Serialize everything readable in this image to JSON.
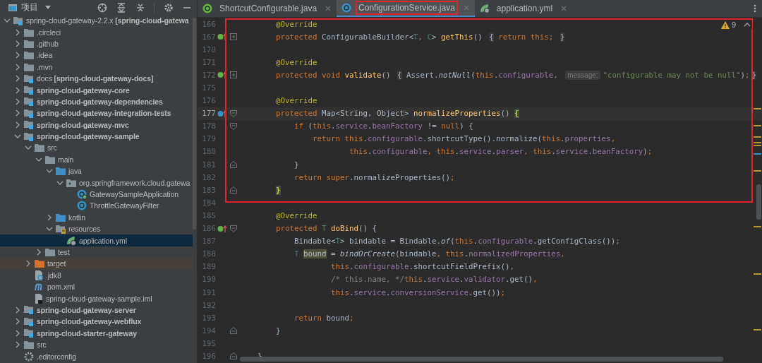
{
  "project_panel": {
    "title": "项目",
    "tree": [
      {
        "label": "spring-cloud-gateway-2.2.x **[spring-cloud-gatewa**",
        "kind": "module-alias",
        "expanded": true,
        "selected": false,
        "children": [
          {
            "label": ".circleci",
            "kind": "folder",
            "expanded": false,
            "selected": false
          },
          {
            "label": ".github",
            "kind": "folder",
            "expanded": false,
            "selected": false
          },
          {
            "label": ".idea",
            "kind": "folder",
            "expanded": false,
            "selected": false
          },
          {
            "label": ".mvn",
            "kind": "folder",
            "expanded": false,
            "selected": false
          },
          {
            "label": "docs **[spring-cloud-gateway-docs]**",
            "kind": "module-alias",
            "expanded": false,
            "selected": false
          },
          {
            "label": "spring-cloud-gateway-core",
            "kind": "module",
            "expanded": false,
            "selected": false
          },
          {
            "label": "spring-cloud-gateway-dependencies",
            "kind": "module",
            "expanded": false,
            "selected": false
          },
          {
            "label": "spring-cloud-gateway-integration-tests",
            "kind": "module",
            "expanded": false,
            "selected": false
          },
          {
            "label": "spring-cloud-gateway-mvc",
            "kind": "module",
            "expanded": false,
            "selected": false
          },
          {
            "label": "spring-cloud-gateway-sample",
            "kind": "module",
            "expanded": true,
            "selected": false,
            "children": [
              {
                "label": "src",
                "kind": "folder",
                "expanded": true,
                "selected": false,
                "children": [
                  {
                    "label": "main",
                    "kind": "folder",
                    "expanded": true,
                    "selected": false,
                    "children": [
                      {
                        "label": "java",
                        "kind": "source",
                        "expanded": true,
                        "selected": false,
                        "children": [
                          {
                            "label": "org.springframework.cloud.gatewa",
                            "kind": "package",
                            "expanded": true,
                            "selected": false,
                            "children": [
                              {
                                "label": "GatewaySampleApplication",
                                "kind": "spring-class",
                                "selected": false
                              },
                              {
                                "label": "ThrottleGatewayFilter",
                                "kind": "class",
                                "selected": false
                              }
                            ]
                          }
                        ]
                      },
                      {
                        "label": "kotlin",
                        "kind": "source",
                        "expanded": false,
                        "selected": false
                      },
                      {
                        "label": "resources",
                        "kind": "resources",
                        "expanded": true,
                        "selected": false,
                        "children": [
                          {
                            "label": "application.yml",
                            "kind": "yml",
                            "selected": true
                          }
                        ]
                      }
                    ]
                  },
                  {
                    "label": "test",
                    "kind": "folder",
                    "expanded": false,
                    "selected": false
                  }
                ]
              },
              {
                "label": "target",
                "kind": "excluded",
                "expanded": false,
                "selected": false
              },
              {
                "label": ".jdk8",
                "kind": "unknown-file",
                "selected": false
              },
              {
                "label": "pom.xml",
                "kind": "maven",
                "selected": false
              },
              {
                "label": "spring-cloud-gateway-sample.iml",
                "kind": "iml",
                "selected": false
              }
            ]
          },
          {
            "label": "spring-cloud-gateway-server",
            "kind": "module",
            "expanded": false,
            "selected": false
          },
          {
            "label": "spring-cloud-gateway-webflux",
            "kind": "module",
            "expanded": false,
            "selected": false
          },
          {
            "label": "spring-cloud-starter-gateway",
            "kind": "module",
            "expanded": false,
            "selected": false
          },
          {
            "label": "src",
            "kind": "folder",
            "expanded": false,
            "selected": false
          },
          {
            "label": ".editorconfig",
            "kind": "config",
            "selected": false
          }
        ]
      }
    ]
  },
  "tabs": [
    {
      "label": "ShortcutConfigurable.java",
      "kind": "interface",
      "selected": false,
      "highlighted": false
    },
    {
      "label": "ConfigurationService.java",
      "kind": "class",
      "selected": true,
      "highlighted": true
    },
    {
      "label": "application.yml",
      "kind": "yml",
      "selected": false,
      "highlighted": false
    }
  ],
  "editor": {
    "warnings": "9",
    "blocks": [
      {
        "boxed": true,
        "lines": [
          {
            "number": "166",
            "tokens": [
              {
                "kind": "annotation",
                "text": "        @Override"
              }
            ]
          },
          {
            "number": "167",
            "gutter": {
              "kind": "override"
            },
            "fold": {
              "kind": "collapsed"
            },
            "tokens": [
              {
                "kind": "keyword",
                "text": "        protected "
              },
              {
                "kind": "plain",
                "text": "ConfigurableBuilder<"
              },
              {
                "kind": "typeparam",
                "text": "T"
              },
              {
                "kind": "keyword",
                "text": ", "
              },
              {
                "kind": "typeparam",
                "text": "C"
              },
              {
                "kind": "plain",
                "text": "> "
              },
              {
                "kind": "method",
                "text": "getThis"
              },
              {
                "kind": "plain",
                "text": "() "
              },
              {
                "kind": "fold",
                "text": "{"
              },
              {
                "kind": "keyword",
                "text": " return this; "
              },
              {
                "kind": "fold",
                "text": "}"
              }
            ]
          },
          {
            "number": "170"
          },
          {
            "number": "171",
            "tokens": [
              {
                "kind": "annotation",
                "text": "        @Override"
              }
            ]
          },
          {
            "number": "172",
            "gutter": {
              "kind": "override"
            },
            "fold": {
              "kind": "collapsed"
            },
            "tokens": [
              {
                "kind": "keyword",
                "text": "        protected void "
              },
              {
                "kind": "method",
                "text": "validate"
              },
              {
                "kind": "plain",
                "text": "() "
              },
              {
                "kind": "fold",
                "text": "{"
              },
              {
                "kind": "plain",
                "text": " Assert."
              },
              {
                "kind": "static",
                "text": "notNull"
              },
              {
                "kind": "plain",
                "text": "("
              },
              {
                "kind": "keyword",
                "text": "this"
              },
              {
                "kind": "plain",
                "text": "."
              },
              {
                "kind": "field",
                "text": "configurable"
              },
              {
                "kind": "keyword",
                "text": ", "
              },
              {
                "kind": "hint",
                "text": "message:"
              },
              {
                "kind": "string",
                "text": "\"configurable may not be null\""
              },
              {
                "kind": "plain",
                "text": ")"
              },
              {
                "kind": "keyword",
                "text": ";"
              },
              {
                "kind": "fold",
                "text": "}"
              }
            ]
          },
          {
            "number": "175"
          },
          {
            "number": "176",
            "tokens": [
              {
                "kind": "annotation",
                "text": "        @Override"
              }
            ]
          },
          {
            "number": "177",
            "gutter": {
              "kind": "implements"
            },
            "fold": {
              "kind": "open"
            },
            "current": true,
            "tokens": [
              {
                "kind": "keyword",
                "text": "        protected "
              },
              {
                "kind": "plain",
                "text": "Map<String, Object> "
              },
              {
                "kind": "method",
                "text": "normalizeProperties"
              },
              {
                "kind": "plain",
                "text": "() "
              },
              {
                "kind": "brace",
                "text": "{"
              }
            ]
          },
          {
            "number": "178",
            "fold": {
              "kind": "open"
            },
            "tokens": [
              {
                "kind": "keyword",
                "text": "            if "
              },
              {
                "kind": "plain",
                "text": "("
              },
              {
                "kind": "keyword",
                "text": "this"
              },
              {
                "kind": "plain",
                "text": "."
              },
              {
                "kind": "field",
                "text": "service"
              },
              {
                "kind": "plain",
                "text": "."
              },
              {
                "kind": "field",
                "text": "beanFactory"
              },
              {
                "kind": "plain",
                "text": " != "
              },
              {
                "kind": "keyword",
                "text": "null"
              },
              {
                "kind": "plain",
                "text": ") {"
              }
            ]
          },
          {
            "number": "179",
            "tokens": [
              {
                "kind": "keyword",
                "text": "                return this"
              },
              {
                "kind": "plain",
                "text": "."
              },
              {
                "kind": "field",
                "text": "configurable"
              },
              {
                "kind": "plain",
                "text": ".shortcutType().normalize("
              },
              {
                "kind": "keyword",
                "text": "this"
              },
              {
                "kind": "plain",
                "text": "."
              },
              {
                "kind": "field",
                "text": "properties"
              },
              {
                "kind": "keyword",
                "text": ","
              }
            ]
          },
          {
            "number": "180",
            "tokens": [
              {
                "kind": "keyword",
                "text": "                        this"
              },
              {
                "kind": "plain",
                "text": "."
              },
              {
                "kind": "field",
                "text": "configurable"
              },
              {
                "kind": "keyword",
                "text": ", this"
              },
              {
                "kind": "plain",
                "text": "."
              },
              {
                "kind": "field",
                "text": "service"
              },
              {
                "kind": "plain",
                "text": "."
              },
              {
                "kind": "field",
                "text": "parser"
              },
              {
                "kind": "keyword",
                "text": ", this"
              },
              {
                "kind": "plain",
                "text": "."
              },
              {
                "kind": "field",
                "text": "service"
              },
              {
                "kind": "plain",
                "text": "."
              },
              {
                "kind": "field",
                "text": "beanFactory"
              },
              {
                "kind": "plain",
                "text": ")"
              },
              {
                "kind": "keyword",
                "text": ";"
              }
            ]
          },
          {
            "number": "181",
            "fold": {
              "kind": "close"
            },
            "tokens": [
              {
                "kind": "plain",
                "text": "            }"
              }
            ]
          },
          {
            "number": "182",
            "tokens": [
              {
                "kind": "keyword",
                "text": "            return super"
              },
              {
                "kind": "plain",
                "text": ".normalizeProperties()"
              },
              {
                "kind": "keyword",
                "text": ";"
              }
            ]
          },
          {
            "number": "183",
            "fold": {
              "kind": "close"
            },
            "tokens": [
              {
                "kind": "brace",
                "text": "        }"
              }
            ]
          }
        ]
      },
      {
        "boxed": false,
        "lines": [
          {
            "number": "184"
          },
          {
            "number": "185",
            "tokens": [
              {
                "kind": "annotation",
                "text": "        @Override"
              }
            ]
          },
          {
            "number": "186",
            "gutter": {
              "kind": "override"
            },
            "fold": {
              "kind": "open"
            },
            "tokens": [
              {
                "kind": "keyword",
                "text": "        protected "
              },
              {
                "kind": "typeparam",
                "text": "T "
              },
              {
                "kind": "method",
                "text": "doBind"
              },
              {
                "kind": "plain",
                "text": "() {"
              }
            ]
          },
          {
            "number": "187",
            "tokens": [
              {
                "kind": "plain",
                "text": "            Bindable<"
              },
              {
                "kind": "typeparam",
                "text": "T"
              },
              {
                "kind": "plain",
                "text": "> bindable = Bindable."
              },
              {
                "kind": "static",
                "text": "of"
              },
              {
                "kind": "plain",
                "text": "("
              },
              {
                "kind": "keyword",
                "text": "this"
              },
              {
                "kind": "plain",
                "text": "."
              },
              {
                "kind": "field",
                "text": "configurable"
              },
              {
                "kind": "plain",
                "text": ".getConfigClass())"
              },
              {
                "kind": "keyword",
                "text": ";"
              }
            ]
          },
          {
            "number": "188",
            "tokens": [
              {
                "kind": "typeparam",
                "text": "            T "
              },
              {
                "kind": "usage",
                "text": "bound"
              },
              {
                "kind": "plain",
                "text": " = "
              },
              {
                "kind": "static",
                "text": "bindOrCreate"
              },
              {
                "kind": "plain",
                "text": "(bindable"
              },
              {
                "kind": "keyword",
                "text": ", this"
              },
              {
                "kind": "plain",
                "text": "."
              },
              {
                "kind": "field",
                "text": "normalizedProperties"
              },
              {
                "kind": "keyword",
                "text": ","
              }
            ]
          },
          {
            "number": "189",
            "tokens": [
              {
                "kind": "keyword",
                "text": "                    this"
              },
              {
                "kind": "plain",
                "text": "."
              },
              {
                "kind": "field",
                "text": "configurable"
              },
              {
                "kind": "plain",
                "text": ".shortcutFieldPrefix()"
              },
              {
                "kind": "keyword",
                "text": ","
              }
            ]
          },
          {
            "number": "190",
            "tokens": [
              {
                "kind": "comment",
                "text": "                    /* this.name, */"
              },
              {
                "kind": "keyword",
                "text": "this"
              },
              {
                "kind": "plain",
                "text": "."
              },
              {
                "kind": "field",
                "text": "service"
              },
              {
                "kind": "plain",
                "text": "."
              },
              {
                "kind": "field",
                "text": "validator"
              },
              {
                "kind": "plain",
                "text": ".get()"
              },
              {
                "kind": "keyword",
                "text": ","
              }
            ]
          },
          {
            "number": "191",
            "tokens": [
              {
                "kind": "keyword",
                "text": "                    this"
              },
              {
                "kind": "plain",
                "text": "."
              },
              {
                "kind": "field",
                "text": "service"
              },
              {
                "kind": "plain",
                "text": "."
              },
              {
                "kind": "field",
                "text": "conversionService"
              },
              {
                "kind": "plain",
                "text": ".get())"
              },
              {
                "kind": "keyword",
                "text": ";"
              }
            ]
          },
          {
            "number": "192"
          },
          {
            "number": "193",
            "tokens": [
              {
                "kind": "keyword",
                "text": "            return "
              },
              {
                "kind": "plain",
                "text": "bound"
              },
              {
                "kind": "keyword",
                "text": ";"
              }
            ]
          },
          {
            "number": "194",
            "fold": {
              "kind": "close"
            },
            "tokens": [
              {
                "kind": "plain",
                "text": "        }"
              }
            ]
          },
          {
            "number": "195"
          },
          {
            "number": "196",
            "fold": {
              "kind": "close"
            },
            "tokens": [
              {
                "kind": "plain",
                "text": "    }"
              }
            ]
          }
        ]
      }
    ]
  }
}
